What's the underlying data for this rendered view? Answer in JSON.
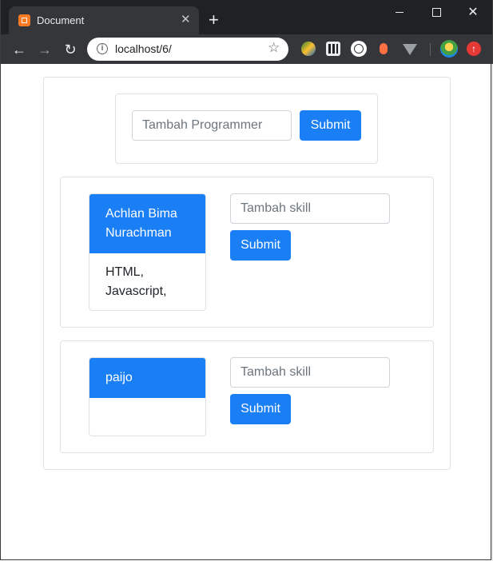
{
  "browser": {
    "tab_title": "Document",
    "url": "localhost/6/"
  },
  "colors": {
    "primary": "#1a7ef5",
    "border": "#dee2e6"
  },
  "add_programmer": {
    "placeholder": "Tambah Programmer",
    "submit_label": "Submit"
  },
  "programmers": [
    {
      "name": "Achlan Bima Nurachman",
      "skills": "HTML, Javascript,",
      "skill_placeholder": "Tambah skill",
      "submit_label": "Submit"
    },
    {
      "name": "paijo",
      "skills": "",
      "skill_placeholder": "Tambah skill",
      "submit_label": "Submit"
    }
  ]
}
